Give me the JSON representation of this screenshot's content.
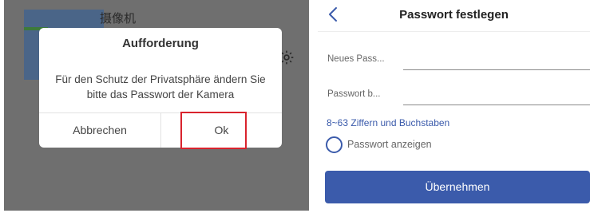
{
  "left_screen": {
    "background_title": "摄像机",
    "dialog": {
      "title": "Aufforderung",
      "message": "Für den Schutz der Privatsphäre ändern Sie bitte das Passwort der Kamera",
      "cancel_label": "Abbrechen",
      "ok_label": "Ok"
    },
    "highlight_color": "#d9232d"
  },
  "right_screen": {
    "header": {
      "title": "Passwort festlegen",
      "back_icon": "chevron-left-icon"
    },
    "fields": [
      {
        "label": "Neues Pass...",
        "value": ""
      },
      {
        "label": "Passwort b...",
        "value": ""
      }
    ],
    "hint": "8~63 Ziffern und Buchstaben",
    "show_password_label": "Passwort anzeigen",
    "apply_label": "Übernehmen",
    "accent_color": "#3b5bab"
  }
}
